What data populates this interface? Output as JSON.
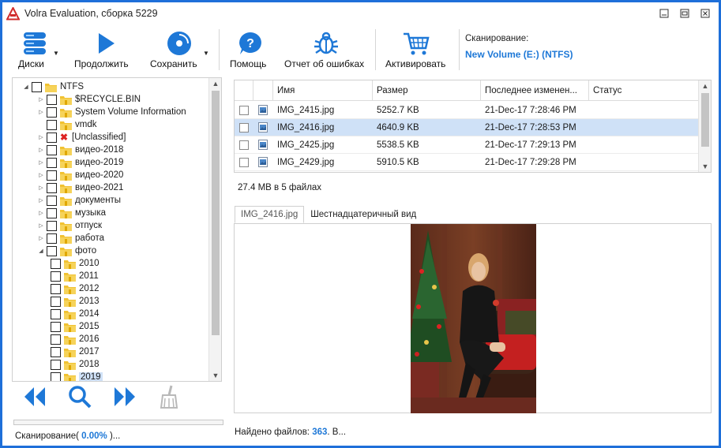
{
  "window": {
    "title": "Volra Evaluation, сборка 5229"
  },
  "toolbar": {
    "disks": "Диски",
    "continue": "Продолжить",
    "save": "Сохранить",
    "help": "Помощь",
    "report": "Отчет об ошибках",
    "activate": "Активировать",
    "scan_label": "Сканирование:",
    "scan_volume": "New Volume (E:) (NTFS)"
  },
  "tree": {
    "items": [
      {
        "label": "NTFS",
        "expanded": true
      },
      {
        "label": "$RECYCLE.BIN"
      },
      {
        "label": "System Volume Information"
      },
      {
        "label": "vmdk"
      },
      {
        "label": "[Unclassified]"
      },
      {
        "label": "видео-2018"
      },
      {
        "label": "видео-2019"
      },
      {
        "label": "видео-2020"
      },
      {
        "label": "видео-2021"
      },
      {
        "label": "документы"
      },
      {
        "label": "музыка"
      },
      {
        "label": "отпуск"
      },
      {
        "label": "работа"
      },
      {
        "label": "фото",
        "expanded": true
      },
      {
        "label": "2010"
      },
      {
        "label": "2011"
      },
      {
        "label": "2012"
      },
      {
        "label": "2013"
      },
      {
        "label": "2014"
      },
      {
        "label": "2015"
      },
      {
        "label": "2016"
      },
      {
        "label": "2017"
      },
      {
        "label": "2018"
      },
      {
        "label": "2019",
        "selected": true
      }
    ]
  },
  "table": {
    "columns": [
      "Имя",
      "Размер",
      "Последнее изменен...",
      "Статус"
    ],
    "rows": [
      {
        "name": "IMG_2415.jpg",
        "size": "5252.7 KB",
        "modified": "21-Dec-17 7:28:46 PM",
        "status": ""
      },
      {
        "name": "IMG_2416.jpg",
        "size": "4640.9 KB",
        "modified": "21-Dec-17 7:28:53 PM",
        "status": "",
        "selected": true
      },
      {
        "name": "IMG_2425.jpg",
        "size": "5538.5 KB",
        "modified": "21-Dec-17 7:29:13 PM",
        "status": ""
      },
      {
        "name": "IMG_2429.jpg",
        "size": "5910.5 KB",
        "modified": "21-Dec-17 7:29:28 PM",
        "status": ""
      }
    ]
  },
  "summary": "27.4 MB в 5 файлах",
  "preview": {
    "tabs": [
      "IMG_2416.jpg",
      "Шестнадцатеричный вид"
    ]
  },
  "status": {
    "scan_prefix": "Сканирование(",
    "scan_percent": "0.00%",
    "scan_suffix": ")...",
    "scan_progress": 0.0,
    "found_prefix": "Найдено файлов:",
    "found_count": "363",
    "found_suffix": ". В..."
  },
  "colors": {
    "accent": "#1e78d7",
    "border": "#1e6fd9",
    "selection": "#cfe1f7"
  }
}
